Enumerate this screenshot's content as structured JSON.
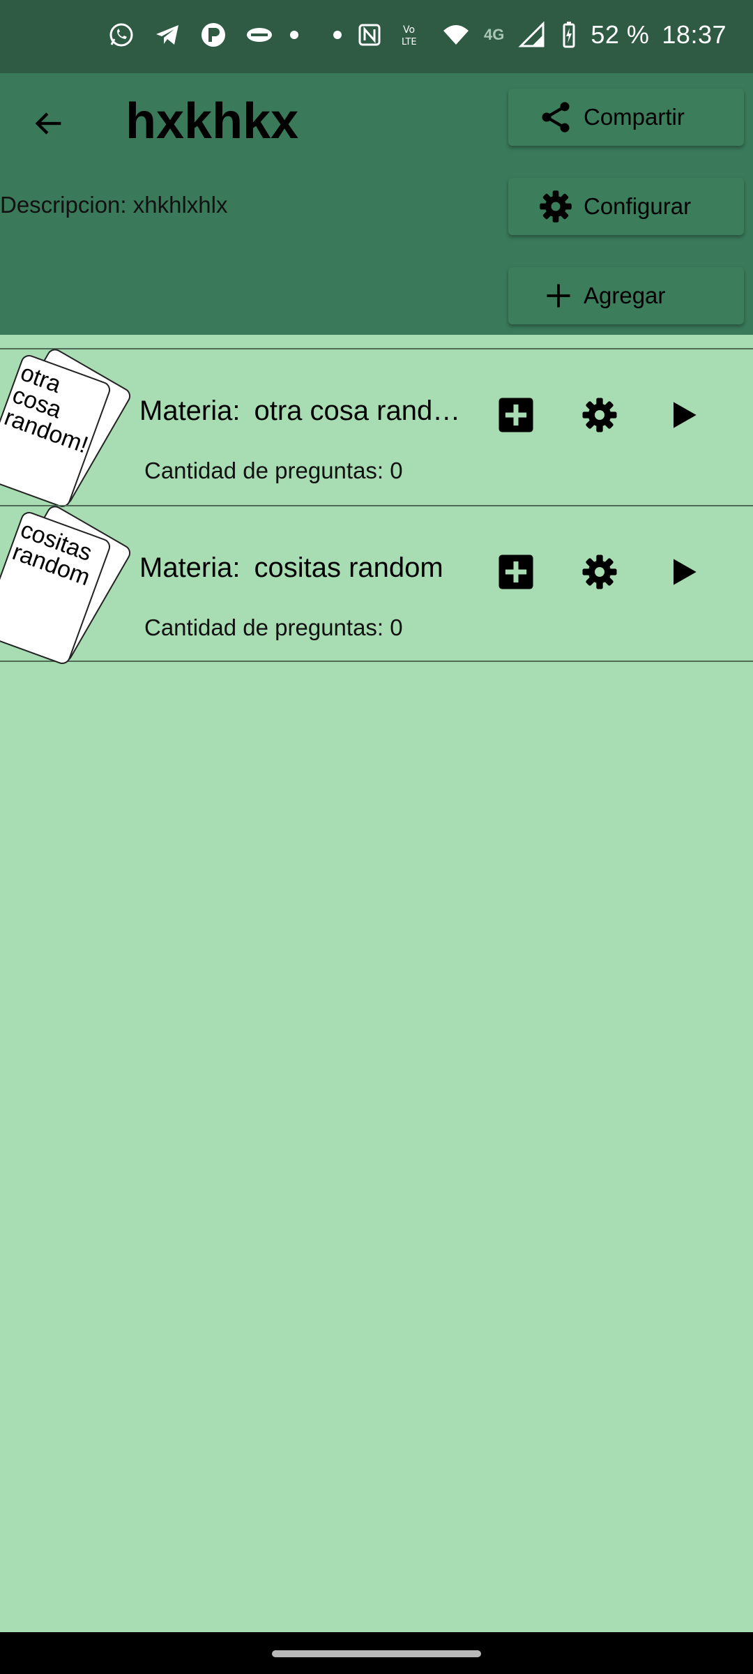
{
  "status_bar": {
    "battery": "52 %",
    "time": "18:37",
    "network": "4G",
    "volte": "VoLTE"
  },
  "header": {
    "title": "hxkhkx",
    "description": "Descripcion: xhkhlxhlx",
    "buttons": {
      "share": "Compartir",
      "configure": "Configurar",
      "add": "Agregar"
    }
  },
  "subjects": [
    {
      "card_text": "otra cosa random!",
      "label": "Materia:",
      "name": "otra cosa rando…",
      "count": "Cantidad de preguntas: 0"
    },
    {
      "card_text": "cositas random",
      "label": "Materia:",
      "name": "cositas random",
      "count": "Cantidad de preguntas: 0"
    }
  ],
  "colors": {
    "status_bar": "#2f5a44",
    "header": "#3a7a5a",
    "background": "#a8dcb2"
  },
  "icons": {
    "back": "arrow-left-icon",
    "share": "share-icon",
    "configure": "gear-icon",
    "add": "plus-icon",
    "row_add": "plus-box-icon",
    "row_settings": "gear-icon",
    "row_play": "play-icon"
  }
}
